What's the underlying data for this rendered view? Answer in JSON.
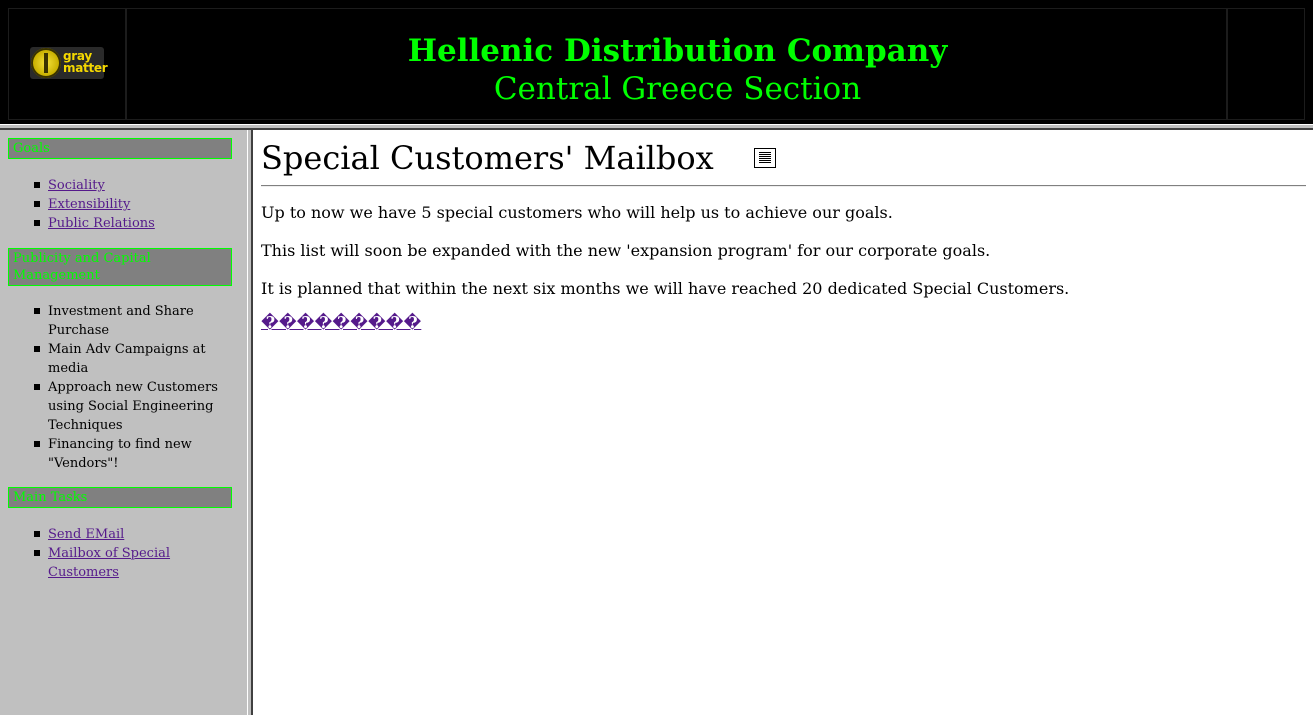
{
  "header": {
    "logo": {
      "line1": "gray",
      "line2": "matter"
    },
    "company_name": "Hellenic Distribution Company",
    "section_name": "Central Greece Section"
  },
  "sidebar": {
    "goals": {
      "heading": "Goals",
      "items": [
        "Sociality",
        "Extensibility",
        "Public Relations"
      ]
    },
    "publicity": {
      "heading": "Publicity and Capital Management",
      "items": [
        "Investment and Share Purchase",
        "Main Adv Campaigns at media",
        "Approach new Customers using Social Engineering Techniques",
        "Financing to find new \"Vendors\"!"
      ]
    },
    "tasks": {
      "heading": "Main Tasks",
      "items": [
        "Send EMail",
        "Mailbox of Special Customers"
      ]
    }
  },
  "main": {
    "title": "Special Customers' Mailbox",
    "paragraphs": [
      "Up to now we have 5 special customers who will help us to achieve our goals.",
      "This list will soon be expanded with the new 'expansion program' for our corporate goals.",
      "It is planned that within the next six months we will have reached 20 dedicated Special Customers."
    ],
    "back_link": "���������"
  },
  "colors": {
    "heading_green": "#00ff00",
    "header_bg": "#000000",
    "sidebar_bg": "#c0c0c0",
    "sidebar_heading_bg": "#808080",
    "link_visited": "#551a8b"
  },
  "icons": {
    "logo": "gray-matter-logo",
    "title_icon": "notepad-icon"
  }
}
